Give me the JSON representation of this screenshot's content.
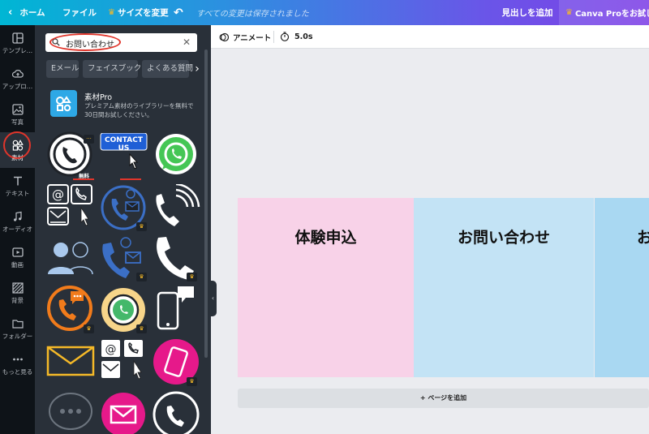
{
  "topbar": {
    "home": "ホーム",
    "file": "ファイル",
    "resize": "サイズを変更",
    "saved_status": "すべての変更は保存されました",
    "add_heading": "見出しを追加",
    "try_pro": "Canva Proをお試しください"
  },
  "sidebar": {
    "items": [
      {
        "label": "テンプレ…",
        "icon": "template-icon"
      },
      {
        "label": "アップロ…",
        "icon": "upload-icon"
      },
      {
        "label": "写真",
        "icon": "photo-icon"
      },
      {
        "label": "素材",
        "icon": "elements-icon"
      },
      {
        "label": "テキスト",
        "icon": "text-icon"
      },
      {
        "label": "オーディオ",
        "icon": "audio-icon"
      },
      {
        "label": "動画",
        "icon": "video-icon"
      },
      {
        "label": "背景",
        "icon": "background-icon"
      },
      {
        "label": "フォルダー",
        "icon": "folder-icon"
      },
      {
        "label": "もっと見る",
        "icon": "more-icon"
      }
    ]
  },
  "panel": {
    "search_value": "お問い合わせ",
    "chips": [
      "Eメール",
      "フェイスブック",
      "よくある質問"
    ],
    "pro": {
      "title": "素材Pro",
      "description": "プレミアム素材のライブラリーを無料で30日間お試しください。"
    },
    "contact_us": "CONTACT US",
    "free_label": "無料"
  },
  "editor": {
    "animate": "アニメート",
    "duration": "5.0s",
    "cards": [
      "体験申込",
      "お問い合わせ",
      "お"
    ],
    "add_page": "+ ページを追加"
  },
  "colors": {
    "accent_red": "#e0352b",
    "card_pink": "#f8d2e8",
    "card_blue": "#c3e3f5",
    "card_blue2": "#a9d8f2"
  }
}
